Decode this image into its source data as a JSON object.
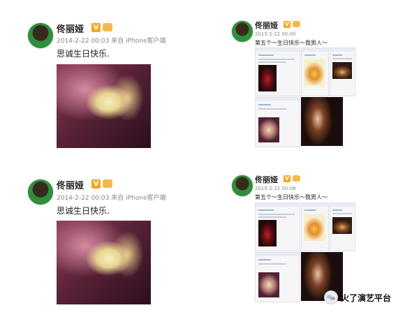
{
  "panels": [
    {
      "user_name": "佟丽娅",
      "meta": "2014-2-22 00:03 来自 iPhone客户端",
      "text": "思诚生日快乐."
    },
    {
      "user_name": "佟丽娅",
      "meta": "2015-2-22 00:00",
      "text": "第五个～生日快乐～我男人～"
    },
    {
      "user_name": "佟丽娅",
      "meta": "2014-2-22 00:03 来自 iPhone客户端",
      "text": "思诚生日快乐."
    },
    {
      "user_name": "佟丽娅",
      "meta": "2015-2-22 00:08",
      "text": "第五个～生日快乐～我男人～"
    }
  ],
  "badges": {
    "verified": "V"
  },
  "watermark": {
    "text": "火了演艺平台",
    "logo_icon": "wechat-logo-icon"
  },
  "icons": [
    "avatar",
    "verified-badge-icon",
    "member-crown-icon",
    "wechat-logo-icon"
  ]
}
